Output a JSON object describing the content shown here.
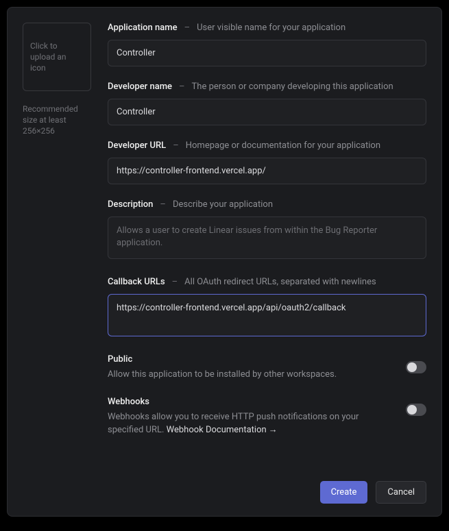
{
  "upload": {
    "prompt": "Click to upload an icon",
    "recommended": "Recommended size at least 256×256"
  },
  "fields": {
    "appName": {
      "label": "Application name",
      "hint": "User visible name for your application",
      "value": "Controller"
    },
    "devName": {
      "label": "Developer name",
      "hint": "The person or company developing this application",
      "value": "Controller"
    },
    "devUrl": {
      "label": "Developer URL",
      "hint": "Homepage or documentation for your application",
      "value": "https://controller-frontend.vercel.app/"
    },
    "description": {
      "label": "Description",
      "hint": "Describe your application",
      "placeholder": "Allows a user to create Linear issues from within the Bug Reporter application."
    },
    "callback": {
      "label": "Callback URLs",
      "hint": "All OAuth redirect URLs, separated with newlines",
      "value": "https://controller-frontend.vercel.app/api/oauth2/callback"
    }
  },
  "toggles": {
    "public": {
      "title": "Public",
      "desc": "Allow this application to be installed by other workspaces."
    },
    "webhooks": {
      "title": "Webhooks",
      "desc": "Webhooks allow you to receive HTTP push notifications on your specified URL. ",
      "link": "Webhook Documentation"
    }
  },
  "actions": {
    "create": "Create",
    "cancel": "Cancel"
  },
  "dash": "–"
}
